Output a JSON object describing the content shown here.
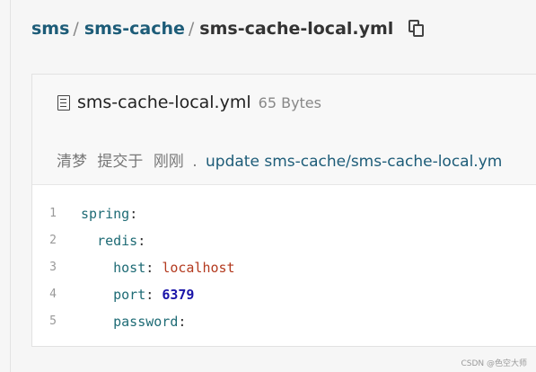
{
  "breadcrumb": {
    "repo": "sms",
    "folder": "sms-cache",
    "file": "sms-cache-local.yml",
    "separator": "/"
  },
  "file": {
    "name": "sms-cache-local.yml",
    "size": "65 Bytes",
    "icon": "file-text-icon"
  },
  "commit": {
    "author": "清梦",
    "action": "提交于",
    "time": "刚刚",
    "dot": ".",
    "message": "update sms-cache/sms-cache-local.ym"
  },
  "code_lines": [
    {
      "no": "1",
      "key": "spring",
      "colon": ":",
      "value": "",
      "indent": ""
    },
    {
      "no": "2",
      "key": "redis",
      "colon": ":",
      "value": "",
      "indent": "  "
    },
    {
      "no": "3",
      "key": "host",
      "colon": ": ",
      "value": "localhost",
      "indent": "    "
    },
    {
      "no": "4",
      "key": "port",
      "colon": ": ",
      "value": "6379",
      "indent": "    "
    },
    {
      "no": "5",
      "key": "password",
      "colon": ":",
      "value": "",
      "indent": "    "
    }
  ],
  "watermark": "CSDN @色空大师",
  "colors": {
    "link": "#1d5c78",
    "yaml_key": "#1e6b75",
    "yaml_string": "#b33a1f",
    "yaml_number": "#1a14a8"
  }
}
